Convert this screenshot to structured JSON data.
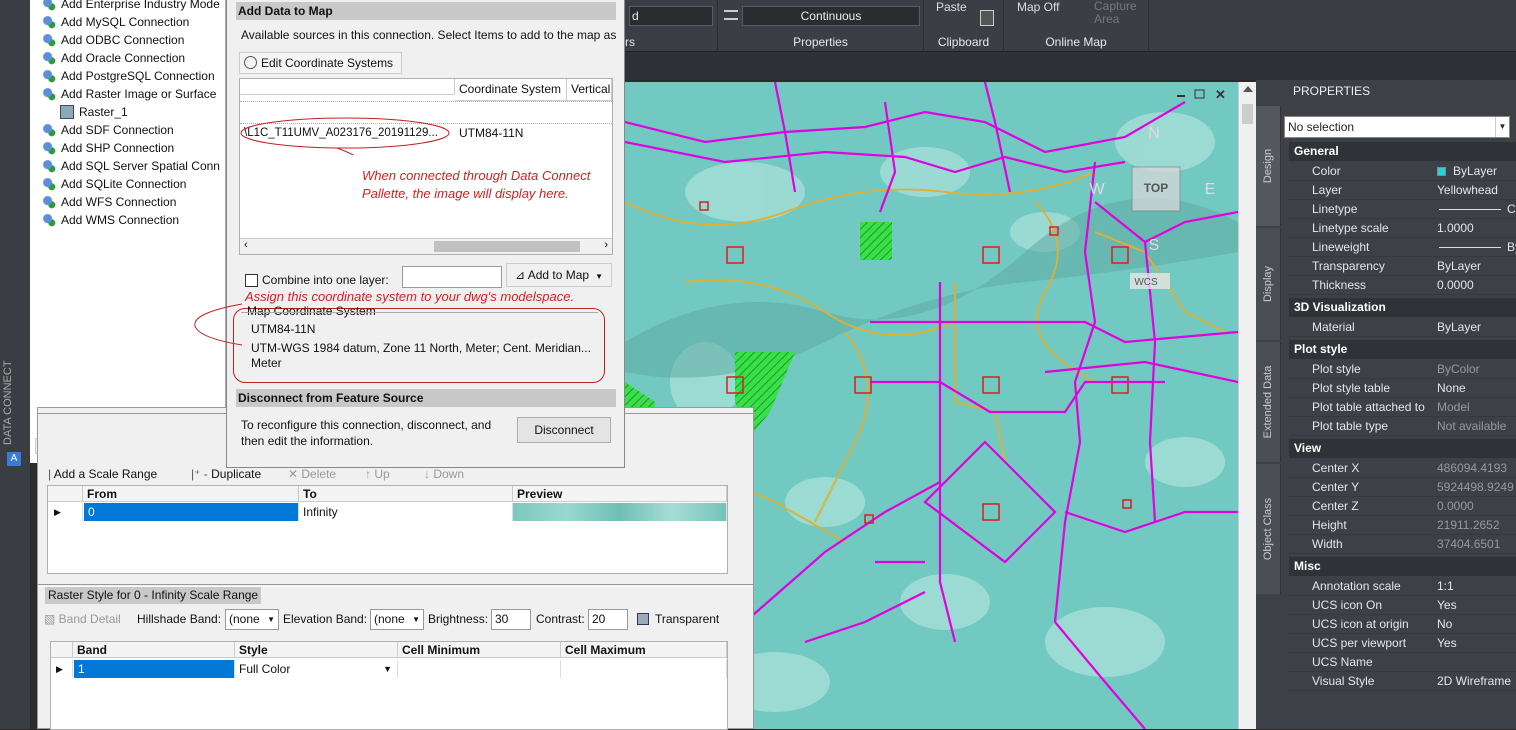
{
  "ribbon": {
    "combo_partial_label": "d",
    "linetype_value": "Continuous",
    "properties_label": "Properties",
    "layers_partial_label": "rs",
    "clipboard_label": "Clipboard",
    "online_map_label": "Online Map",
    "paste_label": "Paste",
    "map_off_label": "Map Off",
    "capture_area_label": "Capture Area"
  },
  "left_panel": {
    "title": "DATA CONNECT"
  },
  "tree": {
    "items": [
      "Add Enterprise Industry Model",
      "Add MySQL Connection",
      "Add ODBC Connection",
      "Add Oracle Connection",
      "Add PostgreSQL Connection",
      "Add Raster Image or Surface C",
      "Raster_1",
      "Add SDF Connection",
      "Add SHP Connection",
      "Add SQL Server Spatial Connec",
      "Add SQLite Connection",
      "Add WFS Connection",
      "Add WMS Connection"
    ]
  },
  "add_data": {
    "header": "Add Data to Map",
    "description": "Available sources in this connection.  Select Items to add to the map as",
    "edit_cs_button": "Edit Coordinate Systems",
    "columns": [
      "Coordinate System",
      "Vertical"
    ],
    "row_name": "\\L1C_T11UMV_A023176_20191129...",
    "row_cs": "UTM84-11N",
    "annotation1_line1": "When connected through Data Connect",
    "annotation1_line2": "Pallette, the image will display here.",
    "combine_label": "Combine into one layer:",
    "add_to_map_button": "Add to Map",
    "annotation2": "Assign this coordinate system to your dwg's modelspace.",
    "map_cs_title": "Map Coordinate System",
    "map_cs_code": "UTM84-11N",
    "map_cs_desc": "UTM-WGS 1984 datum, Zone 11 North, Meter; Cent. Meridian...",
    "map_cs_unit": "Meter"
  },
  "disconnect": {
    "header": "Disconnect from Feature Source",
    "text_line1": "To reconfigure this connection, disconnect, and",
    "text_line2": "then edit the information.",
    "button": "Disconnect"
  },
  "scale_toolbar": {
    "add": "Add a Scale Range",
    "duplicate": "Duplicate",
    "delete": "Delete",
    "up": "Up",
    "down": "Down"
  },
  "scale_grid": {
    "headers": [
      "From",
      "To",
      "Preview"
    ],
    "row": {
      "from": "0",
      "to": "Infinity"
    }
  },
  "raster_style": {
    "title": "Raster Style for 0 - Infinity Scale Range",
    "band_detail": "Band Detail",
    "hillshade_label": "Hillshade Band:",
    "hillshade_value": "(none",
    "elevation_label": "Elevation Band:",
    "elevation_value": "(none",
    "brightness_label": "Brightness:",
    "brightness_value": "30",
    "contrast_label": "Contrast:",
    "contrast_value": "20",
    "transparent_label": "Transparent",
    "headers": [
      "Band",
      "Style",
      "Cell Minimum",
      "Cell Maximum"
    ],
    "row": {
      "band": "1",
      "style": "Full Color"
    }
  },
  "viewcube": {
    "top": "TOP",
    "north": "N",
    "east": "E",
    "west": "W",
    "south": "S",
    "wcs": "WCS"
  },
  "properties": {
    "title": "PROPERTIES",
    "selection": "No selection",
    "tabs": [
      "Design",
      "Display",
      "Extended Data",
      "Object Class"
    ],
    "sections": [
      {
        "name": "General",
        "rows": [
          {
            "k": "Color",
            "v": "ByLayer"
          },
          {
            "k": "Layer",
            "v": "Yellowhead"
          },
          {
            "k": "Linetype",
            "v": "Co"
          },
          {
            "k": "Linetype scale",
            "v": "1.0000"
          },
          {
            "k": "Lineweight",
            "v": "By"
          },
          {
            "k": "Transparency",
            "v": "ByLayer"
          },
          {
            "k": "Thickness",
            "v": "0.0000"
          }
        ]
      },
      {
        "name": "3D Visualization",
        "rows": [
          {
            "k": "Material",
            "v": "ByLayer"
          }
        ]
      },
      {
        "name": "Plot style",
        "rows": [
          {
            "k": "Plot style",
            "v": "ByColor"
          },
          {
            "k": "Plot style table",
            "v": "None"
          },
          {
            "k": "Plot table attached to",
            "v": "Model"
          },
          {
            "k": "Plot table type",
            "v": "Not available"
          }
        ]
      },
      {
        "name": "View",
        "rows": [
          {
            "k": "Center X",
            "v": "486094.4193"
          },
          {
            "k": "Center Y",
            "v": "5924498.9249"
          },
          {
            "k": "Center Z",
            "v": "0.0000"
          },
          {
            "k": "Height",
            "v": "21911.2652"
          },
          {
            "k": "Width",
            "v": "37404.6501"
          }
        ]
      },
      {
        "name": "Misc",
        "rows": [
          {
            "k": "Annotation scale",
            "v": "1:1"
          },
          {
            "k": "UCS icon On",
            "v": "Yes"
          },
          {
            "k": "UCS icon at origin",
            "v": "No"
          },
          {
            "k": "UCS per viewport",
            "v": "Yes"
          },
          {
            "k": "UCS Name",
            "v": ""
          },
          {
            "k": "Visual Style",
            "v": "2D Wireframe"
          }
        ]
      }
    ]
  },
  "colors": {
    "selection": "#0078d7",
    "annotation": "#d62020",
    "magenta": "#e000e0",
    "canvas": "#6ec8c0"
  }
}
